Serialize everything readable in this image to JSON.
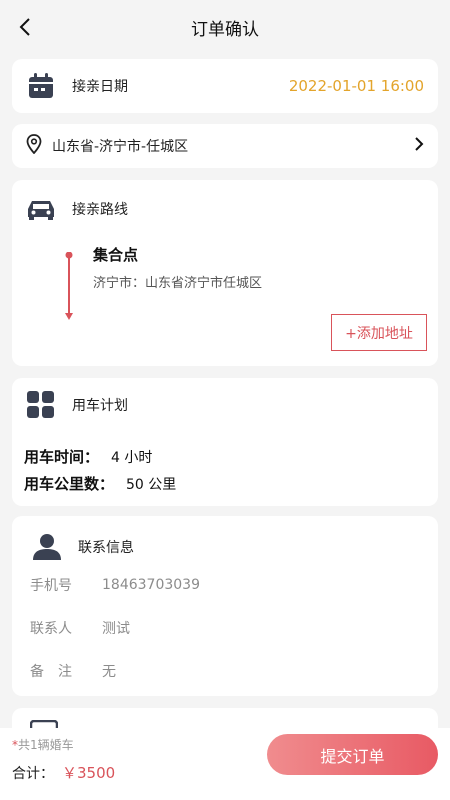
{
  "header": {
    "title": "订单确认"
  },
  "date_card": {
    "label": "接亲日期",
    "value": "2022-01-01 16:00"
  },
  "location": {
    "text": "山东省-济宁市-任城区"
  },
  "route": {
    "title": "接亲路线",
    "gather_title": "集合点",
    "gather_address": "济宁市：山东省济宁市任城区",
    "add_address_label": "+添加地址"
  },
  "plan": {
    "title": "用车计划",
    "time_label": "用车时间：",
    "time_value": "4 小时",
    "distance_label": "用车公里数：",
    "distance_value": "50 公里"
  },
  "contact": {
    "title": "联系信息",
    "phone_label": "手机号",
    "phone_value": "18463703039",
    "name_label": "联系人",
    "name_value": "测试",
    "note_label": "备　注",
    "note_value": "无"
  },
  "footer": {
    "note_star": "*",
    "note_text": "共1辆婚车",
    "total_label": "合计：",
    "total_amount": "￥3500",
    "submit_label": "提交订单"
  },
  "colors": {
    "accent": "#d9535a",
    "date_value": "#e3a42b",
    "icon_dark": "#3a4152"
  }
}
